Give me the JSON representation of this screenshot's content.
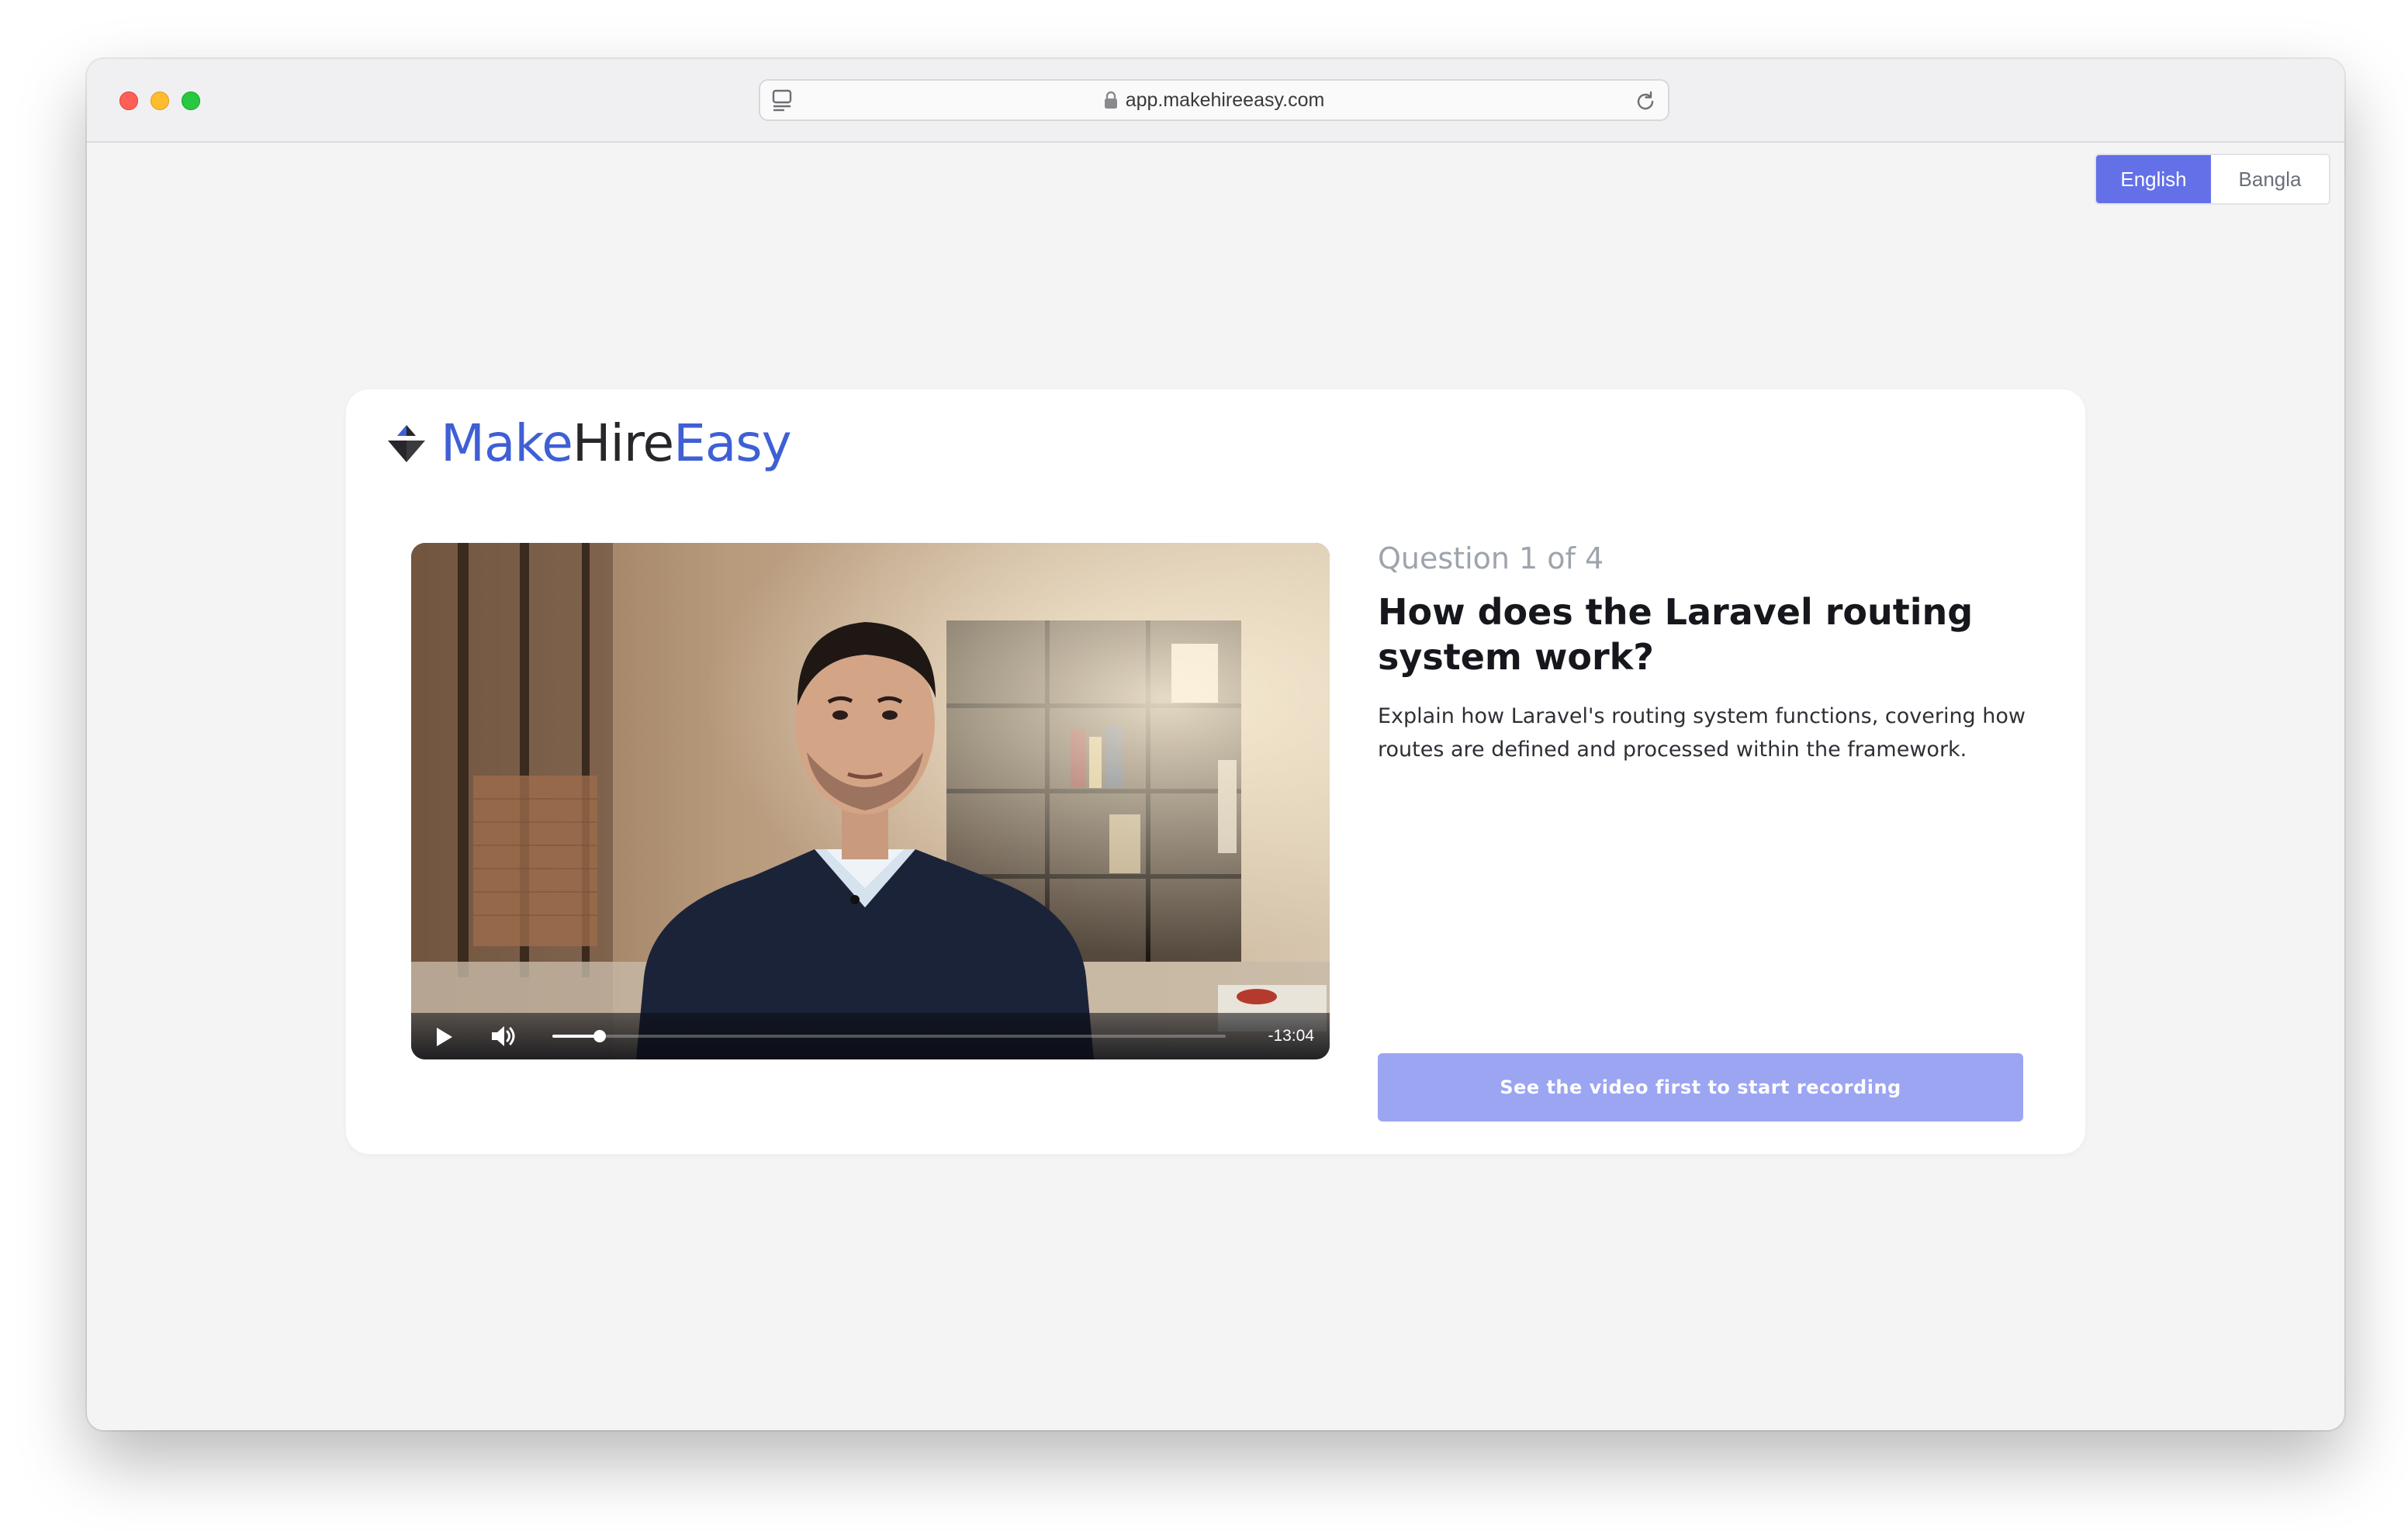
{
  "browser": {
    "url": "app.makehireeasy.com",
    "icons": {
      "reader": "reader-view-icon",
      "lock": "lock-icon",
      "reload": "reload-icon"
    }
  },
  "language_switch": {
    "options": [
      {
        "label": "English",
        "selected": true
      },
      {
        "label": "Bangla",
        "selected": false
      }
    ],
    "accent": "#6470e8"
  },
  "brand": {
    "part1": "Make",
    "part2": "Hire",
    "part3": "Easy",
    "accent": "#3f5fd4",
    "icon": "makehireeasy-logo-icon"
  },
  "video": {
    "time_remaining": "-13:04",
    "progress": 0.07,
    "state": "paused",
    "icons": {
      "play": "play-icon",
      "volume": "volume-icon"
    }
  },
  "question": {
    "counter": "Question 1 of 4",
    "title": "How does the Laravel routing system work?",
    "description": "Explain how Laravel's routing system functions, covering how routes are defined and processed within the framework."
  },
  "record_button": {
    "label": "See the video first to start recording",
    "enabled": false,
    "color": "#9ba5f1"
  }
}
